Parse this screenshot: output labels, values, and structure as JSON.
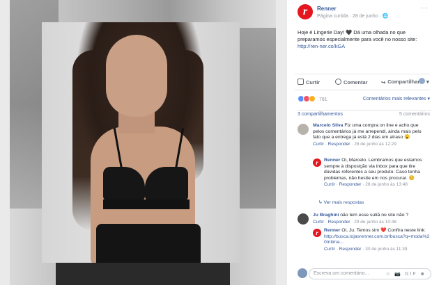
{
  "page": {
    "name": "Renner",
    "logo_letter": "r",
    "meta": "Página curtida · 28 de junho · 🌐",
    "menu": "···"
  },
  "post": {
    "text": "Hoje é Lingerie Day! 🖤 Dá uma olhada no que preparamos especialmente para você no nosso site:",
    "link": "http://ren-ner.co/kGA"
  },
  "actions": {
    "like": "Curtir",
    "comment": "Comentar",
    "share": "Compartilhar"
  },
  "reactions": {
    "count": "781",
    "sort": "Comentários mais relevantes ▾",
    "colors": {
      "like": "#5890ff",
      "love": "#f25268",
      "wow": "#f7b125"
    }
  },
  "stats": {
    "shares": "3 compartilhamentos",
    "comments": "5 comentários"
  },
  "comments": [
    {
      "name": "Marcelo Silva",
      "text": " Fiz uma compra on line e acho que pelos comentários já me arrependi, ainda mais pelo fato que a entrega já está 2 dias em atraso 😮",
      "like": "Curtir",
      "reply": "Responder",
      "time": "· 28 de junho às 12:29"
    },
    {
      "name": "Renner",
      "text": " Oi, Marcelo. Lembramos que estamos sempre à disposição via inbox para que tire dúvidas referentes a seu produto. Caso tenha problemas, não hesite em nos procurar. 😊",
      "like": "Curtir",
      "reply": "Responder",
      "time": "· 28 de junho às 13:48"
    },
    {
      "name": "Ju Braghini",
      "text": " não tem esse sutiã no site não ?",
      "like": "Curtir",
      "reply": "Responder",
      "time": "· 29 de junho às 10:48"
    },
    {
      "name": "Renner",
      "text": " Oi, Ju. Temos sim ❤️ Confira neste link:",
      "link": "http://busca.lojasrenner.com.br/busca?q=moda%20íntima...",
      "like": "Curtir",
      "reply": "Responder",
      "time": "· 30 de junho às 11:39"
    }
  ],
  "more_replies": "↳ Ver mais respostas",
  "input": {
    "placeholder": "Escreva um comentário...",
    "icons": "☺ 📷 GIF ☻"
  }
}
